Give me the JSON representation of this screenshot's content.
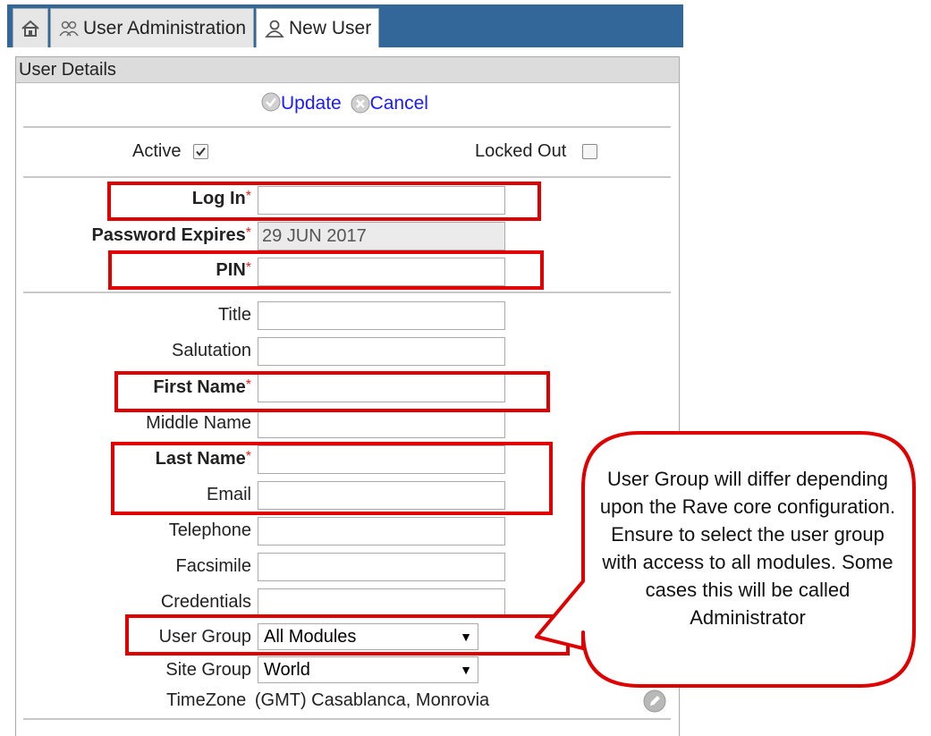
{
  "tabs": [
    {
      "label": "",
      "icon": "home-icon"
    },
    {
      "label": "User Administration",
      "icon": "users-icon"
    },
    {
      "label": "New User",
      "icon": "user-icon"
    }
  ],
  "panel": {
    "title": "User Details"
  },
  "actions": {
    "update": "Update",
    "cancel": "Cancel"
  },
  "status": {
    "active_label": "Active",
    "active_checked": true,
    "locked_label": "Locked Out",
    "locked_checked": false
  },
  "form": {
    "login": {
      "label": "Log In",
      "required": "*",
      "value": ""
    },
    "password_expires": {
      "label": "Password Expires",
      "required": "*",
      "value": "29 JUN 2017"
    },
    "pin": {
      "label": "PIN",
      "required": "*",
      "value": ""
    },
    "title": {
      "label": "Title",
      "value": ""
    },
    "salutation": {
      "label": "Salutation",
      "value": ""
    },
    "first_name": {
      "label": "First Name",
      "required": "*",
      "value": ""
    },
    "middle_name": {
      "label": "Middle Name",
      "value": ""
    },
    "last_name": {
      "label": "Last Name",
      "required": "*",
      "value": ""
    },
    "email": {
      "label": "Email",
      "value": ""
    },
    "telephone": {
      "label": "Telephone",
      "value": ""
    },
    "facsimile": {
      "label": "Facsimile",
      "value": ""
    },
    "credentials": {
      "label": "Credentials",
      "value": ""
    },
    "user_group": {
      "label": "User Group",
      "value": "All Modules"
    },
    "site_group": {
      "label": "Site Group",
      "value": "World"
    },
    "timezone": {
      "label": "TimeZone",
      "value": "(GMT) Casablanca, Monrovia"
    }
  },
  "callout": {
    "text": "User Group will differ depending upon the Rave core configuration.  Ensure to select the user group with access to all modules.  Some cases this will be called Administrator"
  },
  "colors": {
    "tabbar": "#336699",
    "highlight": "#e00000",
    "link": "#1a1aff",
    "required": "#e02020"
  }
}
